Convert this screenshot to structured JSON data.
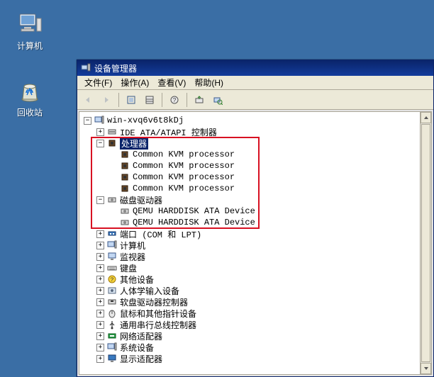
{
  "desktop": {
    "icons": [
      {
        "name": "computer-icon",
        "label": "计算机"
      },
      {
        "name": "recycle-bin-icon",
        "label": "回收站"
      }
    ]
  },
  "window": {
    "title": "设备管理器",
    "menu": {
      "file": {
        "label": "文件(F)"
      },
      "action": {
        "label": "操作(A)"
      },
      "view": {
        "label": "查看(V)"
      },
      "help": {
        "label": "帮助(H)"
      }
    },
    "tree": {
      "root": {
        "label": "win-xvq6v6t8kDj",
        "expanded": true,
        "children": [
          {
            "label": "IDE ATA/ATAPI 控制器",
            "icon": "ide-icon",
            "expanded": false
          },
          {
            "label": "处理器",
            "icon": "cpu-icon",
            "expanded": true,
            "selected": true,
            "children": [
              {
                "label": "Common KVM processor",
                "icon": "cpu-icon"
              },
              {
                "label": "Common KVM processor",
                "icon": "cpu-icon"
              },
              {
                "label": "Common KVM processor",
                "icon": "cpu-icon"
              },
              {
                "label": "Common KVM processor",
                "icon": "cpu-icon"
              }
            ]
          },
          {
            "label": "磁盘驱动器",
            "icon": "disk-icon",
            "expanded": true,
            "children": [
              {
                "label": "QEMU HARDDISK ATA Device",
                "icon": "disk-icon"
              },
              {
                "label": "QEMU HARDDISK ATA Device",
                "icon": "disk-icon"
              }
            ]
          },
          {
            "label": "端口 (COM 和 LPT)",
            "icon": "port-icon",
            "expanded": false
          },
          {
            "label": "计算机",
            "icon": "computer-cat-icon",
            "expanded": false
          },
          {
            "label": "监视器",
            "icon": "monitor-icon",
            "expanded": false
          },
          {
            "label": "键盘",
            "icon": "keyboard-icon",
            "expanded": false
          },
          {
            "label": "其他设备",
            "icon": "other-icon",
            "expanded": false
          },
          {
            "label": "人体学输入设备",
            "icon": "hid-icon",
            "expanded": false
          },
          {
            "label": "软盘驱动器控制器",
            "icon": "floppy-ctrl-icon",
            "expanded": false
          },
          {
            "label": "鼠标和其他指针设备",
            "icon": "mouse-icon",
            "expanded": false
          },
          {
            "label": "通用串行总线控制器",
            "icon": "usb-icon",
            "expanded": false
          },
          {
            "label": "网络适配器",
            "icon": "nic-icon",
            "expanded": false
          },
          {
            "label": "系统设备",
            "icon": "system-icon",
            "expanded": false
          },
          {
            "label": "显示适配器",
            "icon": "display-icon",
            "expanded": false
          }
        ]
      }
    }
  }
}
